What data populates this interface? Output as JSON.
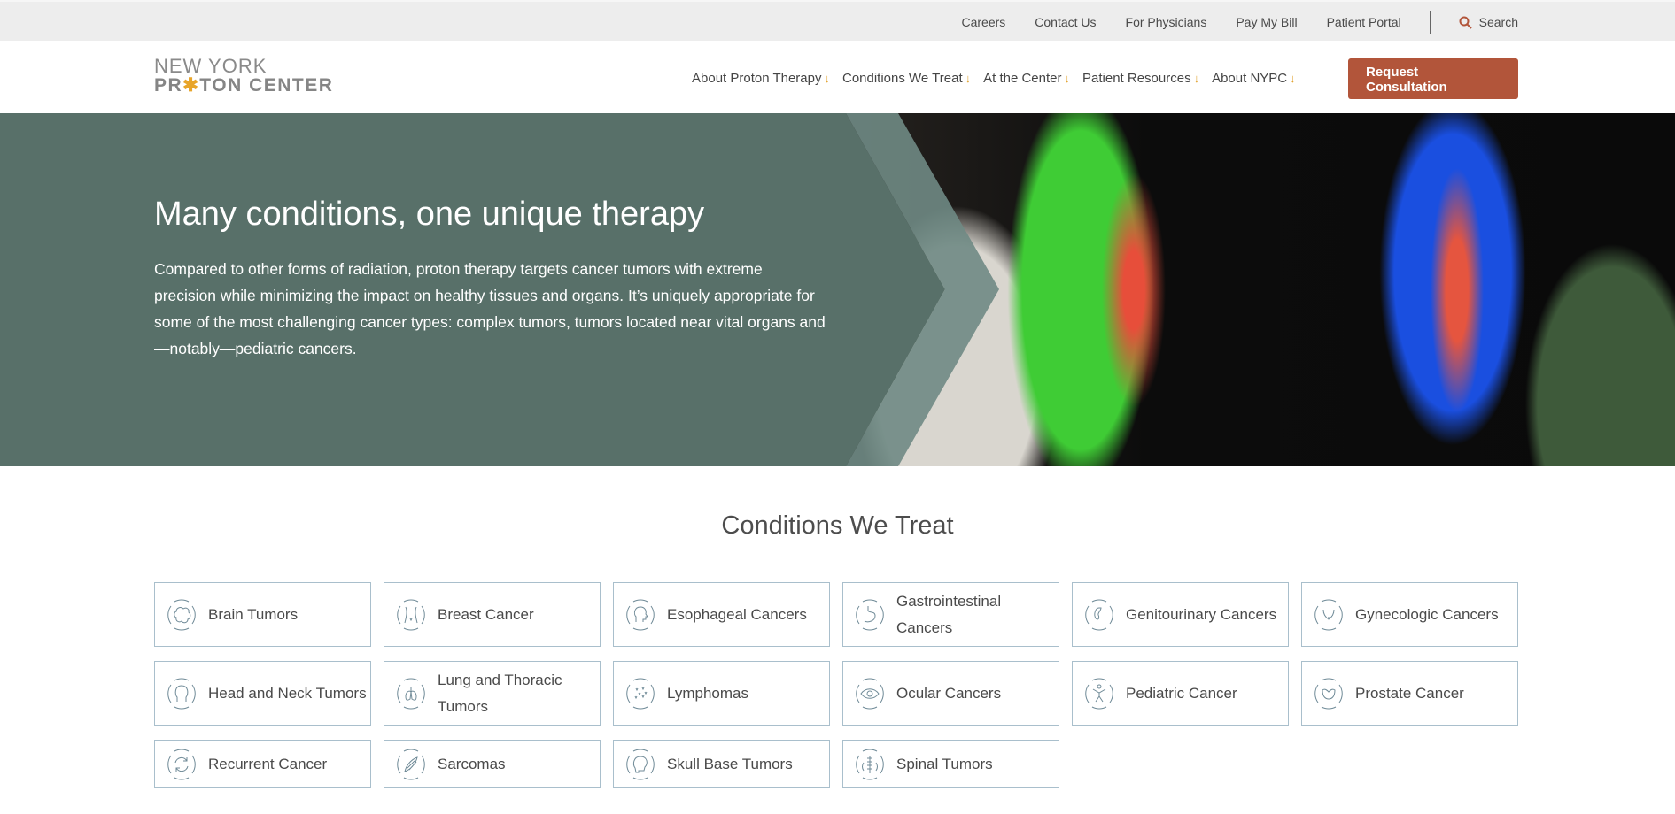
{
  "topbar": {
    "links": [
      "Careers",
      "Contact Us",
      "For Physicians",
      "Pay My Bill",
      "Patient Portal"
    ],
    "search_label": "Search"
  },
  "header": {
    "logo_line1": "NEW YORK",
    "logo_line2_a": "PR",
    "logo_line2_star": "✱",
    "logo_line2_b": "TON CENTER",
    "nav": [
      "About Proton Therapy",
      "Conditions We Treat",
      "At the Center",
      "Patient Resources",
      "About NYPC"
    ],
    "nav_arrow": "↓",
    "cta_label": "Request Consultation",
    "cta_arrow": "→"
  },
  "hero": {
    "title": "Many conditions, one unique therapy",
    "body": "Compared to other forms of radiation, proton therapy targets cancer tumors with extreme precision while minimizing the impact on healthy tissues and organs. It’s uniquely appropriate for some of the most challenging cancer types: complex tumors, tumors located near vital organs and—notably—pediatric cancers."
  },
  "conditions": {
    "title": "Conditions We Treat",
    "items": [
      {
        "label": "Brain Tumors",
        "icon": "brain-icon"
      },
      {
        "label": "Breast Cancer",
        "icon": "torso-icon"
      },
      {
        "label": "Esophageal Cancers",
        "icon": "head-throat-icon"
      },
      {
        "label": "Gastrointestinal Cancers",
        "icon": "stomach-icon"
      },
      {
        "label": "Genitourinary Cancers",
        "icon": "kidney-icon"
      },
      {
        "label": "Gynecologic Cancers",
        "icon": "pelvis-icon"
      },
      {
        "label": "Head and Neck Tumors",
        "icon": "head-icon"
      },
      {
        "label": "Lung and Thoracic Tumors",
        "icon": "lungs-icon"
      },
      {
        "label": "Lymphomas",
        "icon": "cells-icon"
      },
      {
        "label": "Ocular Cancers",
        "icon": "eye-icon"
      },
      {
        "label": "Pediatric Cancer",
        "icon": "child-icon"
      },
      {
        "label": "Prostate Cancer",
        "icon": "prostate-icon"
      },
      {
        "label": "Recurrent Cancer",
        "icon": "recur-icon"
      },
      {
        "label": "Sarcomas",
        "icon": "muscle-icon"
      },
      {
        "label": "Skull Base Tumors",
        "icon": "skull-icon"
      },
      {
        "label": "Spinal Tumors",
        "icon": "spine-icon"
      }
    ]
  },
  "colors": {
    "accent": "#b2553a",
    "hero_teal": "#587069",
    "hero_teal_light": "#6f8a84",
    "arrow": "#e1a12b",
    "card_border": "#a9bfcc"
  }
}
